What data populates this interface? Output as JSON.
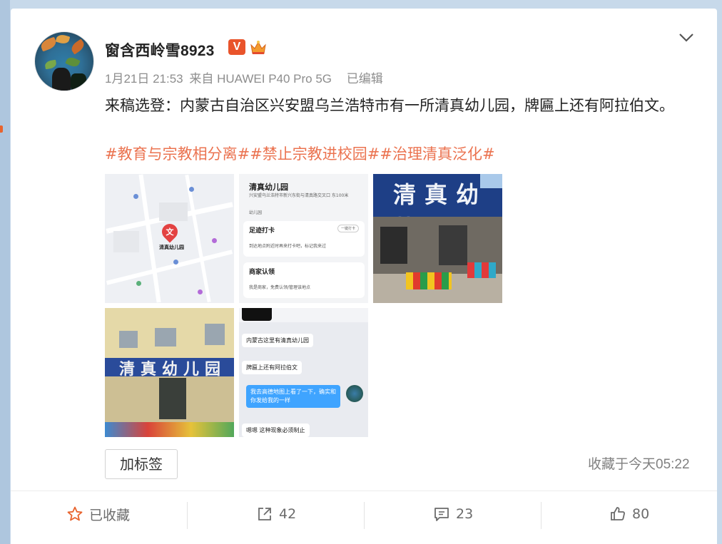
{
  "post": {
    "username": "窗含西岭雪8923",
    "verified_badge": "V",
    "date": "1月21日 21:53",
    "source": "来自 HUAWEI P40 Pro 5G",
    "edited": "已编辑",
    "text": "来稿选登：内蒙古自治区兴安盟乌兰浩特市有一所清真幼儿园，牌匾上还有阿拉伯文。",
    "hashtags": [
      "#教育与宗教相分离#",
      "#禁止宗教进校园#",
      "#治理清真泛化#"
    ],
    "colors": {
      "hashtag": "#eb7350",
      "badge": "#e9542b"
    }
  },
  "images": {
    "map": {
      "pin": "文",
      "label": "清真幼儿园"
    },
    "app": {
      "title": "清真幼儿园",
      "address": "兴安盟乌兰浩特市新兴东街与清真路交叉口 东100米",
      "category": "幼儿园",
      "checkin_title": "足迹打卡",
      "checkin_btn": "一键打卡",
      "checkin_desc": "到达地点附近时再来打卡吧，标记我来过",
      "merchant_title": "商家认领",
      "merchant_desc": "我是商家，免费认领/管理该地点"
    },
    "chat": {
      "msg1": "内蒙古这里有清真幼儿园",
      "msg2": "牌匾上还有阿拉伯文",
      "msg3": "我去高德地图上看了一下，确实和你发给我的一样",
      "msg4": "嗯嗯 这种现象必须制止"
    },
    "storefront": {
      "sign": "清真幼儿园"
    }
  },
  "footer": {
    "tag_button": "加标签",
    "favorite_time": "收藏于今天05:22"
  },
  "actions": {
    "favorite": {
      "label": "已收藏",
      "icon": "star-icon"
    },
    "repost": {
      "count": "42",
      "icon": "share-icon"
    },
    "comment": {
      "count": "23",
      "icon": "comment-icon"
    },
    "like": {
      "count": "80",
      "icon": "thumbs-up-icon"
    }
  }
}
